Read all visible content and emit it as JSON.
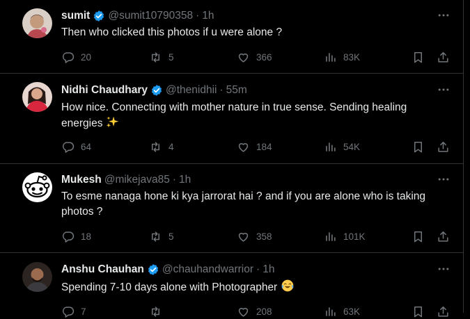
{
  "tweets": [
    {
      "name": "sumit",
      "handle": "@sumit10790358",
      "time": "1h",
      "verified": true,
      "text": "Then who clicked this photos if u were alone ?",
      "text2": "",
      "emoji": "",
      "replies": "20",
      "retweets": "5",
      "likes": "366",
      "views": "83K"
    },
    {
      "name": "Nidhi Chaudhary",
      "handle": "@thenidhii",
      "time": "55m",
      "verified": true,
      "text": "How nice. Connecting with mother nature in true sense. Sending healing",
      "text2": "energies",
      "emoji": "sparkles",
      "replies": "64",
      "retweets": "4",
      "likes": "184",
      "views": "54K"
    },
    {
      "name": "Mukesh",
      "handle": "@mikejava85",
      "time": "1h",
      "verified": false,
      "text": "To esme nanaga hone ki kya jarrorat hai ? and if you are alone who is taking",
      "text2": "photos ?",
      "emoji": "",
      "replies": "18",
      "retweets": "5",
      "likes": "358",
      "views": "101K"
    },
    {
      "name": "Anshu Chauhan",
      "handle": "@chauhandwarrior",
      "time": "1h",
      "verified": true,
      "text": "Spending 7-10 days alone with Photographer",
      "text2": "",
      "emoji": "face-with-tears-of-joy",
      "replies": "7",
      "retweets": "",
      "likes": "208",
      "views": "63K"
    }
  ],
  "separator_dot": "·",
  "colors": {
    "background": "#000000",
    "text": "#e7e9ea",
    "muted": "#71767b",
    "border": "#2f3336",
    "verified": "#1d9bf0"
  }
}
